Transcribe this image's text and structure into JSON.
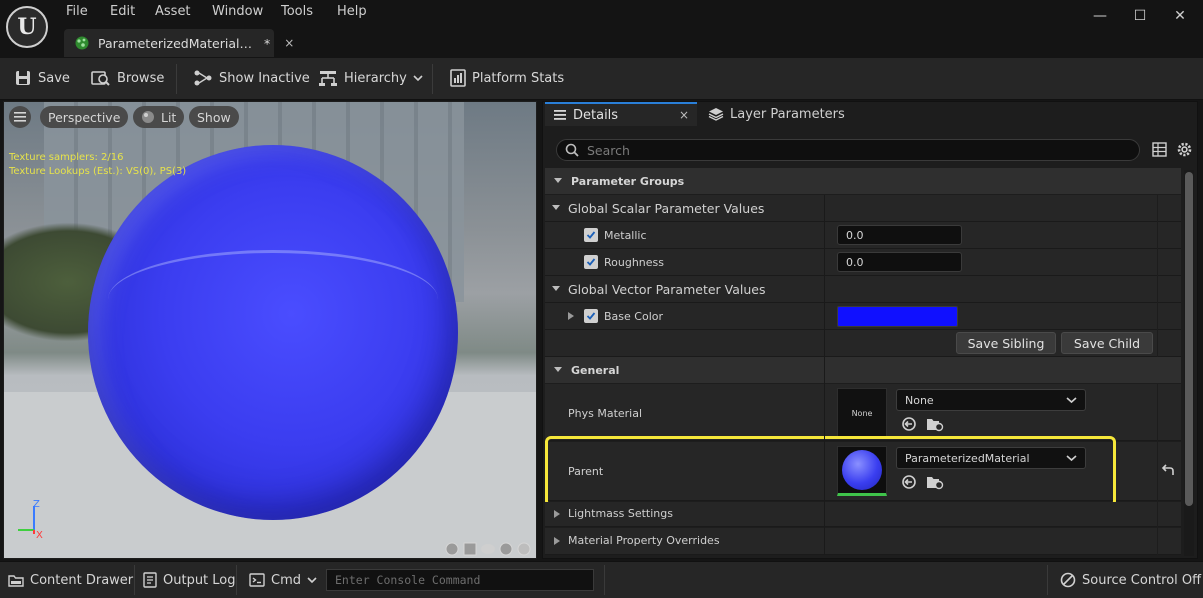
{
  "menu": {
    "items": [
      "File",
      "Edit",
      "Asset",
      "Window",
      "Tools",
      "Help"
    ]
  },
  "document_tab": {
    "title": "ParameterizedMaterial…",
    "modified_mark": "*",
    "close": "×"
  },
  "window_controls": {
    "minimize": "—",
    "maximize": "☐",
    "close": "✕"
  },
  "toolbar": {
    "save": "Save",
    "browse": "Browse",
    "show_inactive": "Show Inactive",
    "hierarchy": "Hierarchy",
    "platform_stats": "Platform Stats"
  },
  "viewport": {
    "perspective": "Perspective",
    "lit": "Lit",
    "show": "Show",
    "stat_samplers": "Texture samplers: 2/16",
    "stat_lookups": "Texture Lookups (Est.): VS(0), PS(3)",
    "axis_z": "Z",
    "axis_x": "X"
  },
  "details": {
    "tab_label": "Details",
    "tab_close": "×",
    "layer_tab_label": "Layer Parameters",
    "search_placeholder": "Search",
    "parameter_groups": "Parameter Groups",
    "global_scalar": "Global Scalar Parameter Values",
    "metallic_label": "Metallic",
    "metallic_value": "0.0",
    "roughness_label": "Roughness",
    "roughness_value": "0.0",
    "global_vector": "Global Vector Parameter Values",
    "base_color_label": "Base Color",
    "base_color_hex": "#1010ff",
    "save_sibling": "Save Sibling",
    "save_child": "Save Child",
    "general": "General",
    "phys_material_label": "Phys Material",
    "phys_thumb_text": "None",
    "phys_dropdown": "None",
    "parent_label": "Parent",
    "parent_dropdown": "ParameterizedMaterial",
    "lightmass": "Lightmass Settings",
    "material_overrides": "Material Property Overrides"
  },
  "bottombar": {
    "content_drawer": "Content Drawer",
    "output_log": "Output Log",
    "cmd": "Cmd",
    "console_placeholder": "Enter Console Command",
    "source_control": "Source Control Off"
  },
  "colors": {
    "highlight": "#f6e73a",
    "accent": "#2a7fd8",
    "sphere": "#3b3df0"
  }
}
